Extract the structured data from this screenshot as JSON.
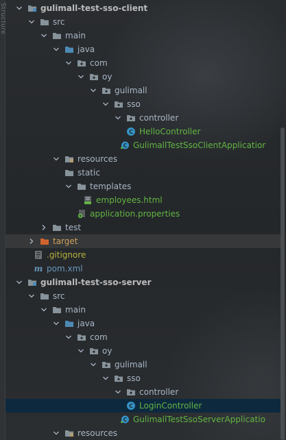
{
  "panel": {
    "side_tab_label": "Structure"
  },
  "tree": [
    {
      "label": "gulimall-test-sso-client",
      "level": 0,
      "chevron": "down",
      "icon": "module-icon",
      "style": "bold"
    },
    {
      "label": "src",
      "level": 1,
      "chevron": "down",
      "icon": "folder-icon",
      "style": "plain"
    },
    {
      "label": "main",
      "level": 2,
      "chevron": "down",
      "icon": "folder-icon",
      "style": "plain"
    },
    {
      "label": "java",
      "level": 3,
      "chevron": "down",
      "icon": "source-folder-icon",
      "style": "plain"
    },
    {
      "label": "com",
      "level": 4,
      "chevron": "down",
      "icon": "package-icon",
      "style": "plain"
    },
    {
      "label": "oy",
      "level": 5,
      "chevron": "down",
      "icon": "package-icon",
      "style": "plain"
    },
    {
      "label": "gulimall",
      "level": 6,
      "chevron": "down",
      "icon": "package-icon",
      "style": "plain"
    },
    {
      "label": "sso",
      "level": 7,
      "chevron": "down",
      "icon": "package-icon",
      "style": "plain"
    },
    {
      "label": "controller",
      "level": 8,
      "chevron": "down",
      "icon": "package-icon",
      "style": "plain"
    },
    {
      "label": "HelloController",
      "level": 9,
      "chevron": "none",
      "icon": "class-icon",
      "style": "green"
    },
    {
      "label": "GulimallTestSsoClientApplicatior",
      "level": 8.5,
      "chevron": "none",
      "icon": "spring-class-icon",
      "style": "green"
    },
    {
      "label": "resources",
      "level": 3,
      "chevron": "down",
      "icon": "resources-folder-icon",
      "style": "plain"
    },
    {
      "label": "static",
      "level": 4,
      "chevron": "none",
      "icon": "folder-icon",
      "style": "plain"
    },
    {
      "label": "templates",
      "level": 4,
      "chevron": "down",
      "icon": "folder-icon",
      "style": "plain"
    },
    {
      "label": "employees.html",
      "level": 5.5,
      "chevron": "none",
      "icon": "html-file-icon",
      "style": "green"
    },
    {
      "label": "application.properties",
      "level": 5,
      "chevron": "none",
      "icon": "properties-file-icon",
      "style": "green"
    },
    {
      "label": "test",
      "level": 2,
      "chevron": "right",
      "icon": "folder-icon",
      "style": "plain"
    },
    {
      "label": "target",
      "level": 1,
      "chevron": "right",
      "icon": "excluded-folder-icon",
      "style": "orange",
      "highlight": true
    },
    {
      "label": ".gitignore",
      "level": 1.5,
      "chevron": "none",
      "icon": "gitignore-icon",
      "style": "olive"
    },
    {
      "label": "pom.xml",
      "level": 1.5,
      "chevron": "none",
      "icon": "maven-icon",
      "style": "blue"
    },
    {
      "label": "gulimall-test-sso-server",
      "level": 0,
      "chevron": "down",
      "icon": "module-icon",
      "style": "bold"
    },
    {
      "label": "src",
      "level": 1,
      "chevron": "down",
      "icon": "folder-icon",
      "style": "plain"
    },
    {
      "label": "main",
      "level": 2,
      "chevron": "down",
      "icon": "folder-icon",
      "style": "plain"
    },
    {
      "label": "java",
      "level": 3,
      "chevron": "down",
      "icon": "source-folder-icon",
      "style": "plain"
    },
    {
      "label": "com",
      "level": 4,
      "chevron": "down",
      "icon": "package-icon",
      "style": "plain"
    },
    {
      "label": "oy",
      "level": 5,
      "chevron": "down",
      "icon": "package-icon",
      "style": "plain"
    },
    {
      "label": "gulimall",
      "level": 6,
      "chevron": "down",
      "icon": "package-icon",
      "style": "plain"
    },
    {
      "label": "sso",
      "level": 7,
      "chevron": "down",
      "icon": "package-icon",
      "style": "plain"
    },
    {
      "label": "controller",
      "level": 8,
      "chevron": "down",
      "icon": "package-icon",
      "style": "plain"
    },
    {
      "label": "LoginController",
      "level": 9,
      "chevron": "none",
      "icon": "class-icon",
      "style": "sel-text",
      "selected": true
    },
    {
      "label": "GulimallTestSsoServerApplicatio",
      "level": 8.5,
      "chevron": "none",
      "icon": "spring-class-icon",
      "style": "green"
    },
    {
      "label": "resources",
      "level": 3,
      "chevron": "down",
      "icon": "resources-folder-icon",
      "style": "plain"
    }
  ],
  "colors": {
    "background": "#26292c",
    "selection": "#0d293e",
    "highlight_row": "#464646",
    "green_text": "#62b543",
    "orange_text": "#d0a15a",
    "blue_text": "#6897bb",
    "class_icon": "#3592c4",
    "folder": "#87939a",
    "source_folder": "#4d8ab5",
    "excluded_folder": "#d0642e"
  }
}
